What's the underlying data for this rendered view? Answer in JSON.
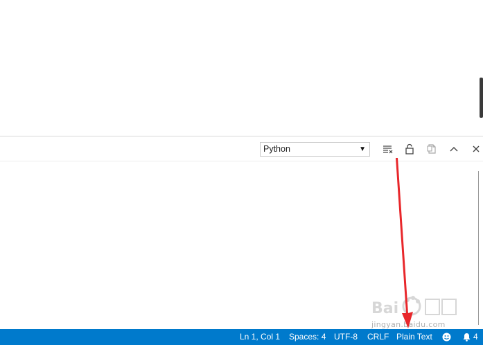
{
  "panel": {
    "channel_select": {
      "selected": "Python",
      "arrow_icon": "triangle-down"
    },
    "actions": [
      {
        "name": "clear-output",
        "icon": "clear-list-icon"
      },
      {
        "name": "toggle-scroll-lock",
        "icon": "unlock-icon"
      },
      {
        "name": "open-log-file",
        "icon": "file-icon"
      },
      {
        "name": "maximize-panel",
        "icon": "chevron-up-icon"
      },
      {
        "name": "close-panel",
        "icon": "close-icon"
      }
    ]
  },
  "status_bar": {
    "background": "#007acc",
    "cursor_position": "Ln 1, Col 1",
    "indentation": "Spaces: 4",
    "encoding": "UTF-8",
    "line_ending": "CRLF",
    "language_mode": "Plain Text",
    "feedback_icon": "smiley-icon",
    "notifications_count": "4",
    "notifications_icon": "bell-icon"
  },
  "annotation": {
    "arrow_color": "#e8272b"
  },
  "watermark": {
    "text": "jingyan.baidu.com",
    "logo": "baidu-jingyan-logo"
  }
}
